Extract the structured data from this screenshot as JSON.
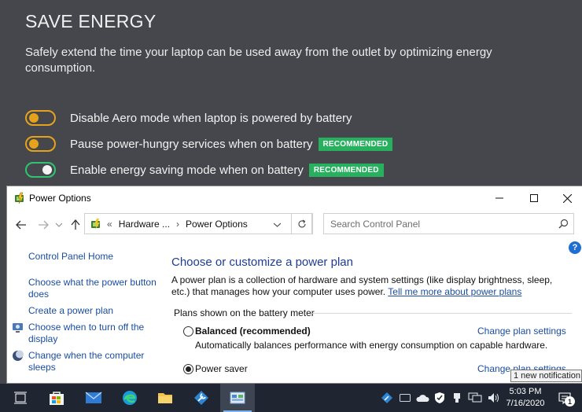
{
  "energy": {
    "title": "SAVE ENERGY",
    "description": "Safely extend the time your laptop can be used away from the outlet by optimizing energy consumption.",
    "options": [
      {
        "label": "Disable Aero mode when laptop is powered by battery",
        "enabled": false,
        "badge": ""
      },
      {
        "label": "Pause power-hungry services when on battery",
        "enabled": false,
        "badge": "RECOMMENDED"
      },
      {
        "label": "Enable energy saving mode when on battery",
        "enabled": true,
        "badge": "RECOMMENDED"
      }
    ],
    "colors": {
      "background": "#45474c",
      "toggle_off": "#e6a21a",
      "toggle_on": "#2ec471",
      "badge": "#27b15f"
    }
  },
  "window": {
    "title": "Power Options",
    "breadcrumb": {
      "separator": "«",
      "parent": "Hardware ...",
      "arrow": "›",
      "current": "Power Options"
    },
    "search_placeholder": "Search Control Panel",
    "sidebar": {
      "home": "Control Panel Home",
      "links": [
        "Choose what the power button does",
        "Create a power plan",
        "Choose when to turn off the display",
        "Change when the computer sleeps"
      ]
    },
    "main": {
      "heading": "Choose or customize a power plan",
      "description": "A power plan is a collection of hardware and system settings (like display brightness, sleep, etc.) that manages how your computer uses power.",
      "learn_more": "Tell me more about power plans",
      "group_label": "Plans shown on the battery meter",
      "plans": [
        {
          "name": "Balanced (recommended)",
          "description": "Automatically balances performance with energy consumption on capable hardware.",
          "selected": false,
          "link": "Change plan settings"
        },
        {
          "name": "Power saver",
          "description": "",
          "selected": true,
          "link": "Change plan settings"
        }
      ]
    },
    "help": "?"
  },
  "taskbar": {
    "time": "5:03 PM",
    "date": "7/16/2020",
    "notification_toast": "1 new notification",
    "notification_count": "1",
    "items": [
      "task-view",
      "microsoft-store",
      "mail",
      "edge",
      "file-explorer",
      "tool",
      "control-panel"
    ]
  }
}
